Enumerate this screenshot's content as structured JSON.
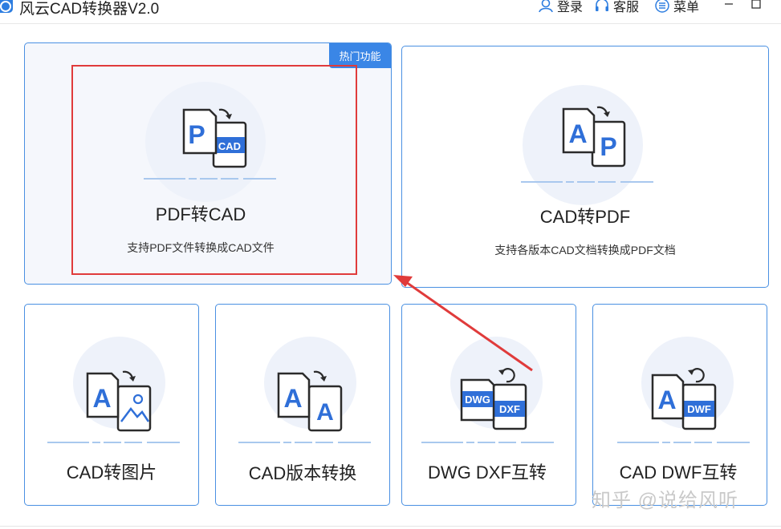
{
  "app": {
    "title": "风云CAD转换器V2.0",
    "login_label": "登录",
    "support_label": "客服",
    "menu_label": "菜单"
  },
  "cards": {
    "pdf_to_cad": {
      "title": "PDF转CAD",
      "desc": "支持PDF文件转换成CAD文件",
      "badge": "热门功能",
      "icon_front": "P",
      "icon_back": "CAD"
    },
    "cad_to_pdf": {
      "title": "CAD转PDF",
      "desc": "支持各版本CAD文档转换成PDF文档",
      "icon_front": "A",
      "icon_back": "P"
    },
    "cad_to_image": {
      "title": "CAD转图片",
      "icon_front": "A"
    },
    "cad_version": {
      "title": "CAD版本转换",
      "icon_front": "A",
      "icon_back": "A"
    },
    "dwg_dxf": {
      "title": "DWG DXF互转",
      "icon_front": "DWG",
      "icon_back": "DXF"
    },
    "cad_dwf": {
      "title": "CAD DWF互转",
      "icon_front": "A",
      "icon_back": "DWF"
    }
  },
  "watermark": "知乎 @说给风听",
  "colors": {
    "accent": "#3a86e6",
    "card_border": "#4a90e2",
    "highlight": "#e03b3b",
    "icon_blue": "#2f6fd8"
  }
}
